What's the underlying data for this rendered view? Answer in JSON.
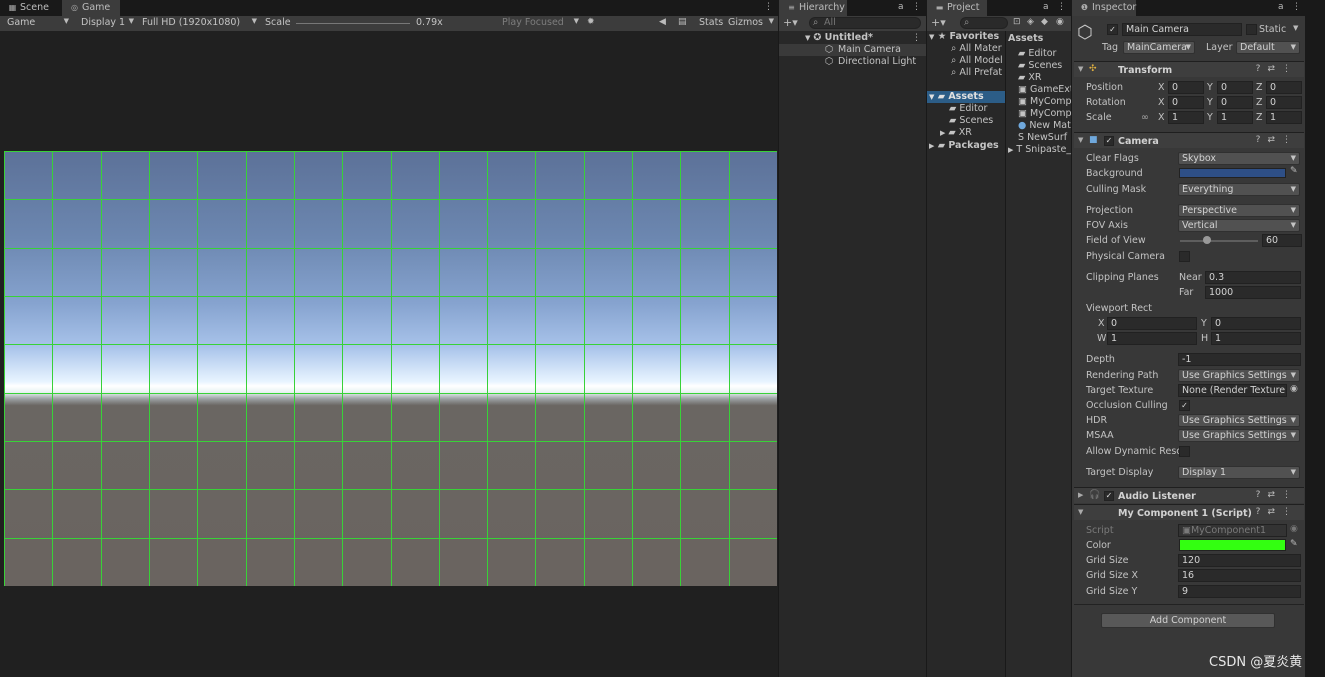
{
  "colors": {
    "accent_selection": "#2c5d87",
    "grid_line": "#38d238",
    "background_color": "#2e4f86",
    "component_color": "#33ff11"
  },
  "scene_tab": "Scene",
  "game_tab": "Game",
  "game_toolbar": {
    "view_mode": "Game",
    "display": "Display 1",
    "resolution": "Full HD (1920x1080)",
    "scale_label": "Scale",
    "scale_value": "0.79x",
    "play_mode": "Play Focused",
    "stats": "Stats",
    "gizmos": "Gizmos"
  },
  "hierarchy": {
    "tab": "Hierarchy",
    "search_placeholder": "All",
    "scene": "Untitled*",
    "items": [
      "Main Camera",
      "Directional Light"
    ]
  },
  "project": {
    "tab": "Project",
    "favorites_label": "Favorites",
    "favorites": [
      "All Mater",
      "All Model",
      "All Prefat"
    ],
    "assets_label": "Assets",
    "asset_folders": [
      "Editor",
      "Scenes",
      "XR"
    ],
    "packages_label": "Packages",
    "content_header": "Assets",
    "content_items": [
      "Editor",
      "Scenes",
      "XR",
      "GameExt",
      "MyComp",
      "MyComp",
      "New Mat",
      "NewSurf",
      "Snipaste_"
    ]
  },
  "inspector": {
    "tab": "Inspector",
    "object_name": "Main Camera",
    "static_label": "Static",
    "tag_label": "Tag",
    "tag_value": "MainCamera",
    "layer_label": "Layer",
    "layer_value": "Default",
    "transform": {
      "title": "Transform",
      "position_label": "Position",
      "rotation_label": "Rotation",
      "scale_label": "Scale",
      "axis_x": "X",
      "axis_y": "Y",
      "axis_z": "Z",
      "position": [
        "0",
        "0",
        "0"
      ],
      "rotation": [
        "0",
        "0",
        "0"
      ],
      "scale": [
        "1",
        "1",
        "1"
      ]
    },
    "camera": {
      "title": "Camera",
      "clear_flags_label": "Clear Flags",
      "clear_flags": "Skybox",
      "background_label": "Background",
      "culling_mask_label": "Culling Mask",
      "culling_mask": "Everything",
      "projection_label": "Projection",
      "projection": "Perspective",
      "fov_axis_label": "FOV Axis",
      "fov_axis": "Vertical",
      "fov_label": "Field of View",
      "fov": "60",
      "physical_camera_label": "Physical Camera",
      "clipping_label": "Clipping Planes",
      "near_label": "Near",
      "near": "0.3",
      "far_label": "Far",
      "far": "1000",
      "viewport_label": "Viewport Rect",
      "vx_label": "X",
      "vx": "0",
      "vy_label": "Y",
      "vy": "0",
      "vw_label": "W",
      "vw": "1",
      "vh_label": "H",
      "vh": "1",
      "depth_label": "Depth",
      "depth": "-1",
      "rendering_path_label": "Rendering Path",
      "rendering_path": "Use Graphics Settings",
      "target_texture_label": "Target Texture",
      "target_texture": "None (Render Texture)",
      "occlusion_label": "Occlusion Culling",
      "hdr_label": "HDR",
      "hdr": "Use Graphics Settings",
      "msaa_label": "MSAA",
      "msaa": "Use Graphics Settings",
      "dynamic_res_label": "Allow Dynamic Resc",
      "target_display_label": "Target Display",
      "target_display": "Display 1"
    },
    "audio_listener": {
      "title": "Audio Listener"
    },
    "my_component": {
      "title": "My Component 1 (Script)",
      "script_label": "Script",
      "script_value": "MyComponent1",
      "color_label": "Color",
      "grid_size_label": "Grid Size",
      "grid_size": "120",
      "grid_size_x_label": "Grid Size X",
      "grid_size_x": "16",
      "grid_size_y_label": "Grid Size Y",
      "grid_size_y": "9"
    },
    "add_component": "Add Component"
  },
  "watermark": "CSDN @夏炎黄"
}
